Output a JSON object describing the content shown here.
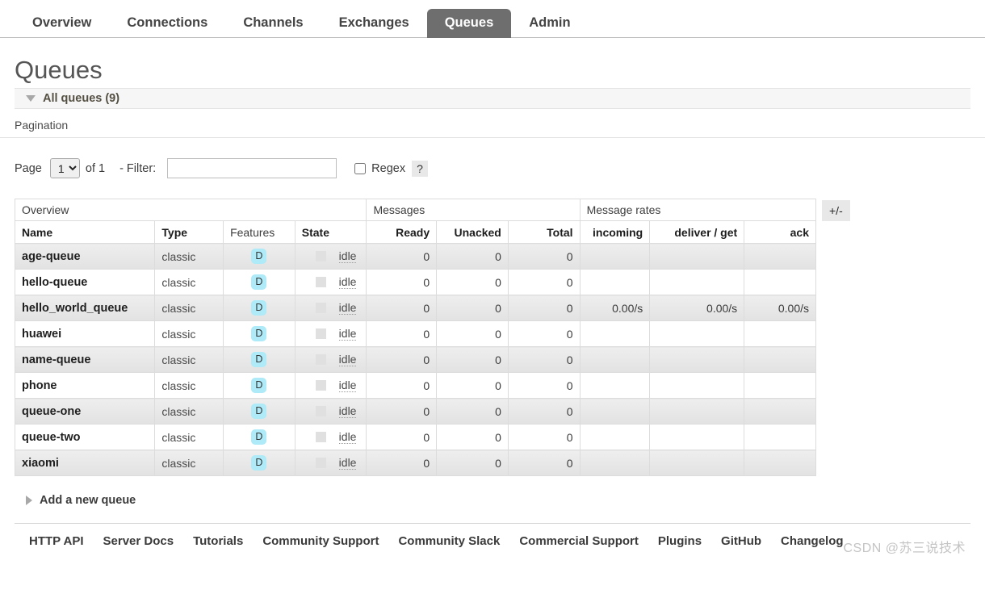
{
  "nav": {
    "tabs": [
      {
        "label": "Overview",
        "active": false
      },
      {
        "label": "Connections",
        "active": false
      },
      {
        "label": "Channels",
        "active": false
      },
      {
        "label": "Exchanges",
        "active": false
      },
      {
        "label": "Queues",
        "active": true
      },
      {
        "label": "Admin",
        "active": false
      }
    ]
  },
  "page": {
    "title": "Queues",
    "section_header": "All queues (9)"
  },
  "pagination": {
    "label": "Pagination",
    "page_text": "Page",
    "page_value": "1",
    "page_options": [
      "1"
    ],
    "of_text": "of 1",
    "filter_label": "- Filter:",
    "filter_value": "",
    "filter_placeholder": "",
    "regex_label": "Regex",
    "regex_checked": false,
    "help_label": "?"
  },
  "table": {
    "group_headers": [
      "Overview",
      "Messages",
      "Message rates"
    ],
    "columns": [
      "Name",
      "Type",
      "Features",
      "State",
      "Ready",
      "Unacked",
      "Total",
      "incoming",
      "deliver / get",
      "ack"
    ],
    "plus_minus_label": "+/-",
    "feature_badge": "D",
    "rows": [
      {
        "name": "age-queue",
        "type": "classic",
        "features": "D",
        "state": "idle",
        "ready": "0",
        "unacked": "0",
        "total": "0",
        "incoming": "",
        "deliver_get": "",
        "ack": ""
      },
      {
        "name": "hello-queue",
        "type": "classic",
        "features": "D",
        "state": "idle",
        "ready": "0",
        "unacked": "0",
        "total": "0",
        "incoming": "",
        "deliver_get": "",
        "ack": ""
      },
      {
        "name": "hello_world_queue",
        "type": "classic",
        "features": "D",
        "state": "idle",
        "ready": "0",
        "unacked": "0",
        "total": "0",
        "incoming": "0.00/s",
        "deliver_get": "0.00/s",
        "ack": "0.00/s"
      },
      {
        "name": "huawei",
        "type": "classic",
        "features": "D",
        "state": "idle",
        "ready": "0",
        "unacked": "0",
        "total": "0",
        "incoming": "",
        "deliver_get": "",
        "ack": ""
      },
      {
        "name": "name-queue",
        "type": "classic",
        "features": "D",
        "state": "idle",
        "ready": "0",
        "unacked": "0",
        "total": "0",
        "incoming": "",
        "deliver_get": "",
        "ack": ""
      },
      {
        "name": "phone",
        "type": "classic",
        "features": "D",
        "state": "idle",
        "ready": "0",
        "unacked": "0",
        "total": "0",
        "incoming": "",
        "deliver_get": "",
        "ack": ""
      },
      {
        "name": "queue-one",
        "type": "classic",
        "features": "D",
        "state": "idle",
        "ready": "0",
        "unacked": "0",
        "total": "0",
        "incoming": "",
        "deliver_get": "",
        "ack": ""
      },
      {
        "name": "queue-two",
        "type": "classic",
        "features": "D",
        "state": "idle",
        "ready": "0",
        "unacked": "0",
        "total": "0",
        "incoming": "",
        "deliver_get": "",
        "ack": ""
      },
      {
        "name": "xiaomi",
        "type": "classic",
        "features": "D",
        "state": "idle",
        "ready": "0",
        "unacked": "0",
        "total": "0",
        "incoming": "",
        "deliver_get": "",
        "ack": ""
      }
    ]
  },
  "add_queue": {
    "label": "Add a new queue"
  },
  "footer": {
    "links": [
      "HTTP API",
      "Server Docs",
      "Tutorials",
      "Community Support",
      "Community Slack",
      "Commercial Support",
      "Plugins",
      "GitHub",
      "Changelog"
    ],
    "watermark": "CSDN @苏三说技术"
  },
  "colors": {
    "active_tab_bg": "#6e6e6e",
    "feature_badge_bg": "#aeeaf7",
    "row_stripe": "#e6e6e6"
  }
}
